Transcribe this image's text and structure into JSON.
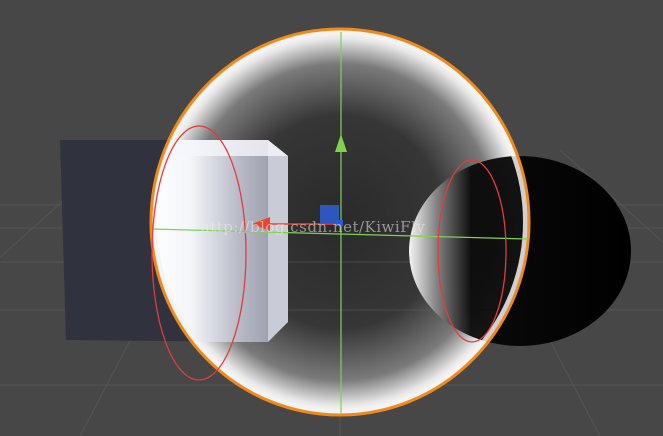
{
  "scene": {
    "objects": [
      {
        "name": "cube",
        "kind": "Cube"
      },
      {
        "name": "sphere-selected",
        "kind": "Sphere",
        "selected": true
      },
      {
        "name": "sphere-back",
        "kind": "Sphere"
      }
    ],
    "gizmo": {
      "icons": [
        "move-y-arrow-icon",
        "move-x-arrow-icon",
        "move-plane-handle-icon"
      ]
    },
    "colors": {
      "background": "#474747",
      "grid": "#5a5a5a",
      "selection_outline": "#f08a1c",
      "annotation": "#e23c3c",
      "axis_y": "#7ed34e",
      "axis_x": "#e8452b",
      "axis_z": "#2e5fd6"
    }
  },
  "watermark": "http://blog.csdn.net/KiwiFly"
}
